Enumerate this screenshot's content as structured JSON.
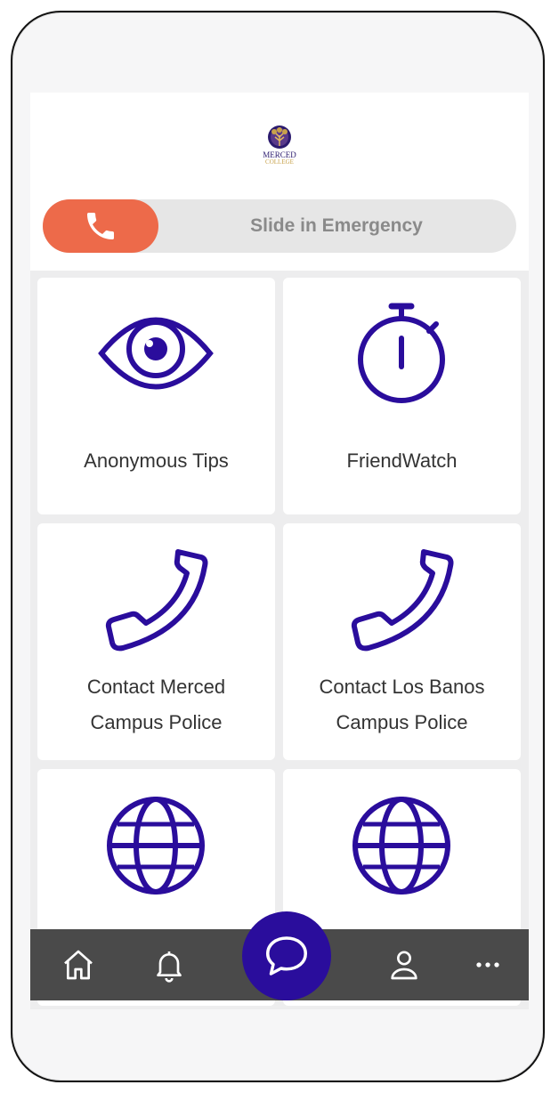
{
  "header": {
    "logo_text": "MERCED",
    "logo_subtext": "COLLEGE"
  },
  "emergency": {
    "label": "Slide in Emergency"
  },
  "tiles": [
    {
      "label": "Anonymous Tips",
      "icon": "eye-icon"
    },
    {
      "label": "FriendWatch",
      "icon": "stopwatch-icon"
    },
    {
      "label_line1": "Contact Merced",
      "label_line2": "Campus Police",
      "icon": "phone-icon"
    },
    {
      "label_line1": "Contact Los Banos",
      "label_line2": "Campus Police",
      "icon": "phone-icon"
    },
    {
      "label": "",
      "icon": "globe-icon"
    },
    {
      "label": "",
      "icon": "globe-icon"
    }
  ],
  "navbar": {
    "items": [
      "home-icon",
      "bell-icon",
      "chat-icon",
      "user-icon",
      "more-icon"
    ]
  },
  "colors": {
    "accent": "#2a0d9c",
    "emergency": "#ed6a4a",
    "navbar": "#4a4a4a"
  }
}
